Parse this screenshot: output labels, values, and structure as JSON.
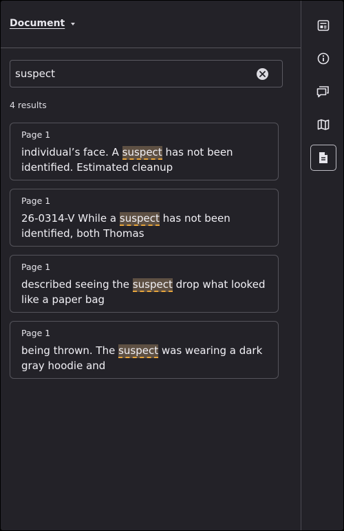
{
  "header": {
    "document_label": "Document"
  },
  "search": {
    "value": "suspect",
    "placeholder": ""
  },
  "results": {
    "count_label": "4 results",
    "items": [
      {
        "page": "Page 1",
        "before": "individual’s face. A ",
        "match": "suspect",
        "after": " has not been identified. Estimated cleanup"
      },
      {
        "page": "Page 1",
        "before": "26-0314-V While a ",
        "match": "suspect",
        "after": " has not been identified, both Thomas"
      },
      {
        "page": "Page 1",
        "before": "described seeing the ",
        "match": "suspect",
        "after": " drop what looked like a paper bag"
      },
      {
        "page": "Page 1",
        "before": "being thrown. The ",
        "match": "suspect",
        "after": " was wearing a dark gray hoodie and"
      }
    ]
  },
  "rail": {
    "buttons": [
      {
        "name": "outline-icon"
      },
      {
        "name": "info-icon"
      },
      {
        "name": "comments-icon"
      },
      {
        "name": "map-icon"
      },
      {
        "name": "document-icon",
        "active": true
      }
    ]
  },
  "colors": {
    "background": "#232228",
    "highlight": "#5e5043",
    "highlight_underline": "#e8a53b",
    "border": "#55545b"
  }
}
